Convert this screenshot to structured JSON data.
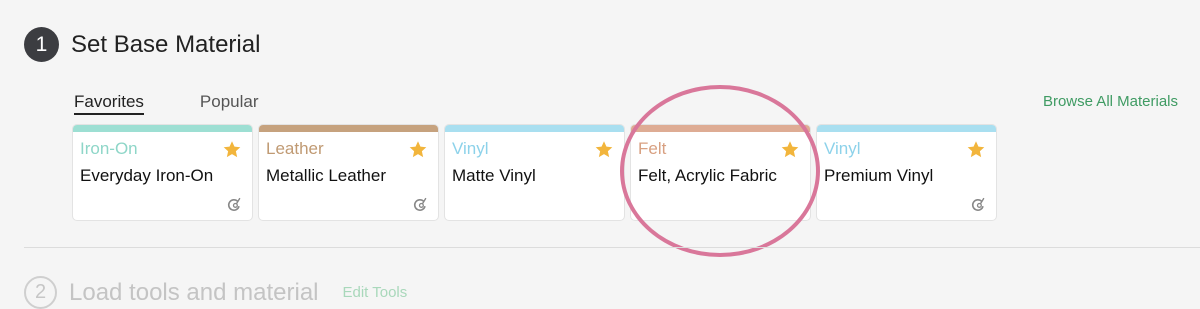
{
  "step1": {
    "number": "1",
    "title": "Set Base Material"
  },
  "tabs": [
    {
      "label": "Favorites",
      "active": true
    },
    {
      "label": "Popular",
      "active": false
    }
  ],
  "browse_link": "Browse All Materials",
  "materials": [
    {
      "category": "Iron-On",
      "name": "Everyday Iron-On",
      "color": "#9ddfd3",
      "category_color": "#8ed6c8",
      "favorite": true,
      "star_icon": "star-icon",
      "brand_icon": "cricut-icon"
    },
    {
      "category": "Leather",
      "name": "Metallic Leather",
      "color": "#c6a27e",
      "category_color": "#c09a73",
      "favorite": true,
      "star_icon": "star-icon",
      "brand_icon": "cricut-icon"
    },
    {
      "category": "Vinyl",
      "name": "Matte Vinyl",
      "color": "#a9dff0",
      "category_color": "#8dd2ea",
      "favorite": true,
      "star_icon": "star-icon",
      "brand_icon": null
    },
    {
      "category": "Felt",
      "name": "Felt, Acrylic Fabric",
      "color": "#deac94",
      "category_color": "#d8a081",
      "favorite": true,
      "star_icon": "star-icon",
      "brand_icon": null
    },
    {
      "category": "Vinyl",
      "name": "Premium Vinyl",
      "color": "#a9dff0",
      "category_color": "#8dd2ea",
      "favorite": true,
      "star_icon": "star-icon",
      "brand_icon": "cricut-icon"
    }
  ],
  "step2": {
    "number": "2",
    "title": "Load tools and material",
    "edit_link": "Edit Tools"
  },
  "colors": {
    "accent_green": "#3f9b63",
    "star": "#f2b53c",
    "highlight": "#d9779a"
  }
}
